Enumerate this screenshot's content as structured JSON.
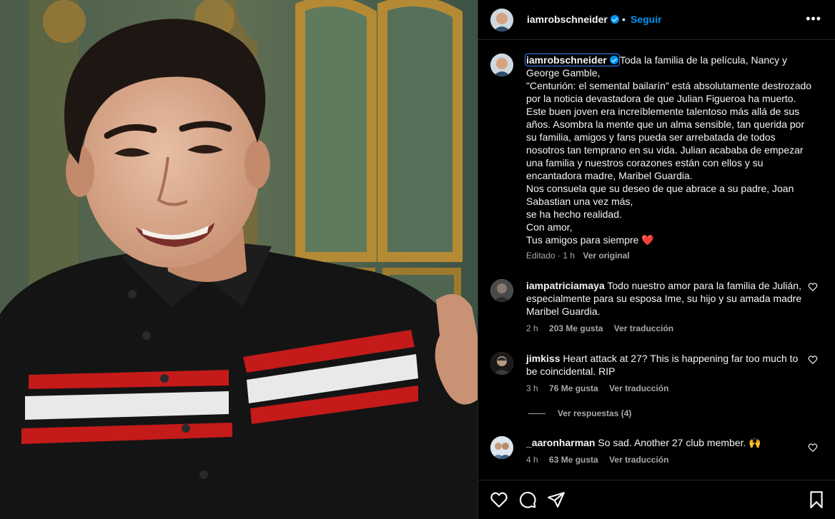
{
  "post": {
    "username": "iamrobschneider",
    "follow_label": "Seguir",
    "more_icon": "more-horizontal-icon",
    "verified_icon": "verified-badge-icon"
  },
  "caption": {
    "username": "iamrobschneider",
    "text": "Toda la familia de la película, Nancy y George Gamble,\n\"Centurión: el semental bailarín\" está absolutamente destrozado por la noticia devastadora de que Julian Figueroa ha muerto. Este buen joven era increíblemente talentoso más allá de sus años. Asombra la mente que un alma sensible, tan querida por su familia, amigos y fans pueda ser arrebatada de todos nosotros tan temprano en su vida. Julian acababa de empezar una familia y nuestros corazones están con ellos y su encantadora madre, Maribel Guardia.\nNos consuela que su deseo de que abrace a su padre, Joan Sabastian una vez más,\nse ha hecho realidad.\nCon amor,\nTus amigos para siempre ❤️",
    "edited": "Editado · 1 h",
    "see_original": "Ver original"
  },
  "comments": [
    {
      "username": "iampatriciamaya",
      "text": "Todo nuestro amor para la familia de Julián, especialmente para su esposa Ime, su hijo y su amada madre Maribel Guardia.",
      "time": "2 h",
      "likes": "203 Me gusta",
      "translate": "Ver traducción"
    },
    {
      "username": "jimkiss",
      "text": "Heart attack at 27? This is happening far too much to be coincidental. RIP",
      "time": "3 h",
      "likes": "76 Me gusta",
      "translate": "Ver traducción",
      "replies": "Ver respuestas (4)"
    },
    {
      "username": "_aaronharman",
      "text": "So sad. Another 27 club member. 🙌",
      "time": "4 h",
      "likes": "63 Me gusta",
      "translate": "Ver traducción"
    }
  ],
  "actions": {
    "like_icon": "heart-icon",
    "comment_icon": "comment-icon",
    "share_icon": "send-icon",
    "save_icon": "bookmark-icon"
  },
  "colors": {
    "accent": "#0095f6",
    "background": "#000000",
    "secondary_text": "#a8a8a8"
  }
}
